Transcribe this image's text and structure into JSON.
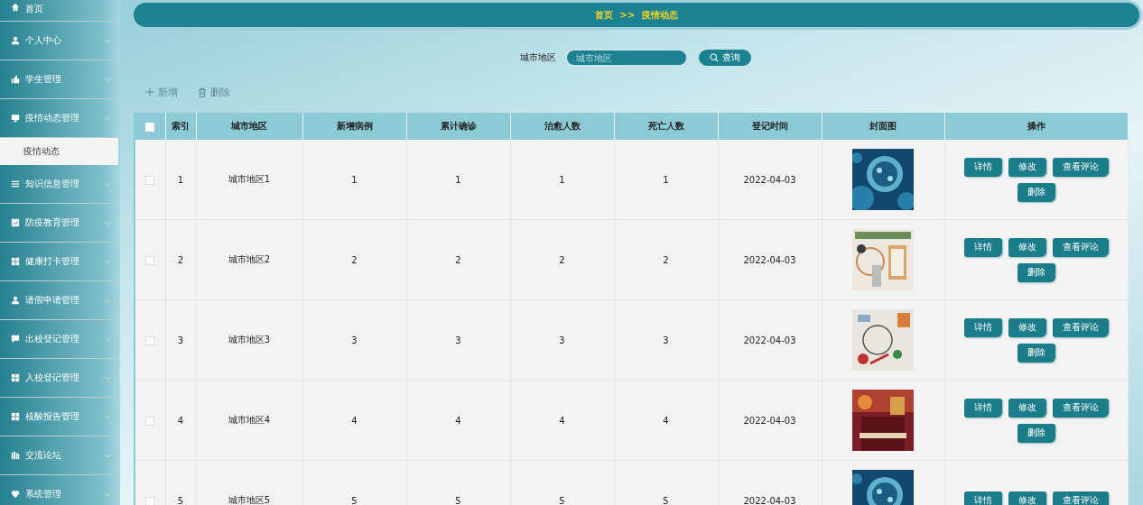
{
  "sidebar": {
    "items": [
      {
        "label": "首页",
        "expandable": false
      },
      {
        "label": "个人中心",
        "expandable": true,
        "expanded": false
      },
      {
        "label": "学生管理",
        "expandable": true,
        "expanded": false
      },
      {
        "label": "疫情动态管理",
        "expandable": true,
        "expanded": true,
        "children": [
          {
            "label": "疫情动态",
            "selected": true
          }
        ]
      },
      {
        "label": "知识信息管理",
        "expandable": true,
        "expanded": false
      },
      {
        "label": "防疫教育管理",
        "expandable": true,
        "expanded": false
      },
      {
        "label": "健康打卡管理",
        "expandable": true,
        "expanded": false
      },
      {
        "label": "请假申请管理",
        "expandable": true,
        "expanded": false
      },
      {
        "label": "出校登记管理",
        "expandable": true,
        "expanded": false
      },
      {
        "label": "入校登记管理",
        "expandable": true,
        "expanded": false
      },
      {
        "label": "核酸报告管理",
        "expandable": true,
        "expanded": false
      },
      {
        "label": "交流论坛",
        "expandable": true,
        "expanded": false
      },
      {
        "label": "系统管理",
        "expandable": true,
        "expanded": false
      }
    ]
  },
  "breadcrumb": {
    "home": "首页",
    "separator": ">>",
    "current": "疫情动态"
  },
  "search": {
    "label": "城市地区",
    "placeholder": "城市地区",
    "button": "查询"
  },
  "actions": {
    "add": "新增",
    "delete": "删除"
  },
  "table": {
    "select_all": {
      "checked": false
    },
    "columns": [
      "索引",
      "城市地区",
      "新增病例",
      "累计确诊",
      "治愈人数",
      "死亡人数",
      "登记时间",
      "封面图",
      "操作"
    ],
    "rows": [
      {
        "checked": false,
        "cells": [
          "1",
          "城市地区1",
          "1",
          "1",
          "1",
          "1",
          "2022-04-03"
        ],
        "cover": {
          "kind": "picture"
        },
        "buttons": [
          "详情",
          "修改",
          "查看评论",
          "删除"
        ]
      },
      {
        "checked": false,
        "cells": [
          "2",
          "城市地区2",
          "2",
          "2",
          "2",
          "2",
          "2022-04-03"
        ],
        "cover": {
          "kind": "picture"
        },
        "buttons": [
          "详情",
          "修改",
          "查看评论",
          "删除"
        ]
      },
      {
        "checked": false,
        "cells": [
          "3",
          "城市地区3",
          "3",
          "3",
          "3",
          "3",
          "2022-04-03"
        ],
        "cover": {
          "kind": "picture"
        },
        "buttons": [
          "详情",
          "修改",
          "查看评论",
          "删除"
        ]
      },
      {
        "checked": false,
        "cells": [
          "4",
          "城市地区4",
          "4",
          "4",
          "4",
          "4",
          "2022-04-03"
        ],
        "cover": {
          "kind": "picture"
        },
        "buttons": [
          "详情",
          "修改",
          "查看评论",
          "删除"
        ]
      },
      {
        "checked": false,
        "cells": [
          "5",
          "城市地区5",
          "5",
          "5",
          "5",
          "5",
          "2022-04-03"
        ],
        "cover": {
          "kind": "picture"
        },
        "buttons": [
          "详情",
          "修改",
          "查看评论"
        ]
      }
    ]
  }
}
